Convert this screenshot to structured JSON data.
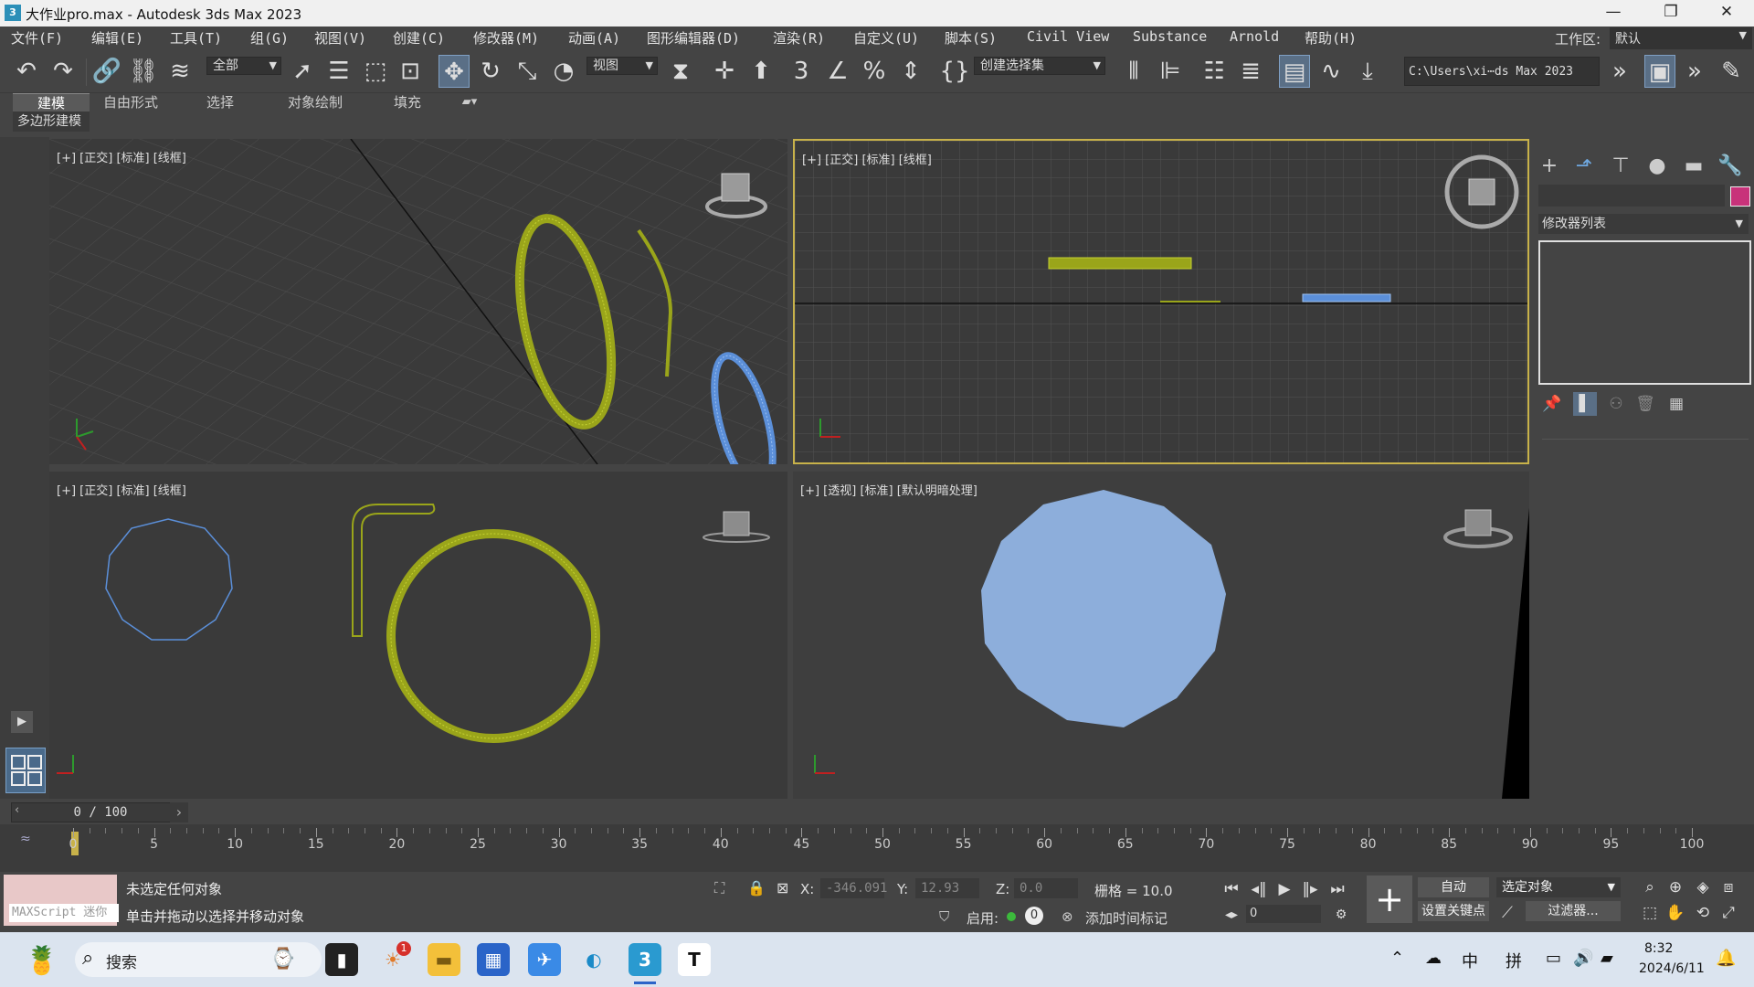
{
  "window": {
    "title": "大作业pro.max - Autodesk 3ds Max 2023",
    "minimize": "—",
    "restore": "❐",
    "close": "✕",
    "app_icon": "3"
  },
  "menu": {
    "items": [
      "文件(F)",
      "编辑(E)",
      "工具(T)",
      "组(G)",
      "视图(V)",
      "创建(C)",
      "修改器(M)",
      "动画(A)",
      "图形编辑器(D)",
      "渲染(R)",
      "自定义(U)",
      "脚本(S)",
      "Civil View",
      "Substance",
      "Arnold",
      "帮助(H)"
    ],
    "workspace_label": "工作区:",
    "workspace_value": "默认"
  },
  "toolbar": {
    "selection_filter": "全部",
    "ref_coord": "视图",
    "named_selection": "创建选择集",
    "path": "C:\\Users\\xi⋯ds Max 2023"
  },
  "ribbon": {
    "tabs": [
      "建模",
      "自由形式",
      "选择",
      "对象绘制",
      "填充"
    ],
    "sub_label": "多边形建模"
  },
  "viewports": {
    "top_left": {
      "label": "[+] [正交] [标准] [线框]"
    },
    "top_right": {
      "label": "[+] [正交] [标准] [线框]"
    },
    "bottom_left": {
      "label": "[+] [正交] [标准] [线框]"
    },
    "bottom_right": {
      "label": "[+] [透视] [标准] [默认明暗处理]"
    }
  },
  "command_panel": {
    "modifier_list": "修改器列表"
  },
  "timeline": {
    "slider": "0 / 100",
    "ticks": [
      "0",
      "5",
      "10",
      "15",
      "20",
      "25",
      "30",
      "35",
      "40",
      "45",
      "50",
      "55",
      "60",
      "65",
      "70",
      "75",
      "80",
      "85",
      "90",
      "95",
      "100"
    ]
  },
  "status": {
    "maxscript": "MAXScript 迷你",
    "line1": "未选定任何对象",
    "line2": "单击并拖动以选择并移动对象",
    "x_label": "X:",
    "x": "-346.091",
    "y_label": "Y:",
    "y": "12.93",
    "z_label": "Z:",
    "z": "0.0",
    "grid": "栅格 = 10.0",
    "enable": "启用:",
    "add_time_tag": "添加时间标记",
    "auto_key": "自动",
    "set_key": "设置关键点",
    "selected_objects": "选定对象",
    "filters": "过滤器...",
    "frame": "0"
  },
  "taskbar": {
    "search": "搜索",
    "notification_badge": "1",
    "time": "8:32",
    "date": "2024/6/11",
    "ime1": "中",
    "ime2": "拼"
  },
  "colors": {
    "selected_yellow": "#9aa51a",
    "blue_object": "#5b8fd9",
    "shaded_blue": "#8daedb",
    "active_border": "#c8b24a"
  }
}
